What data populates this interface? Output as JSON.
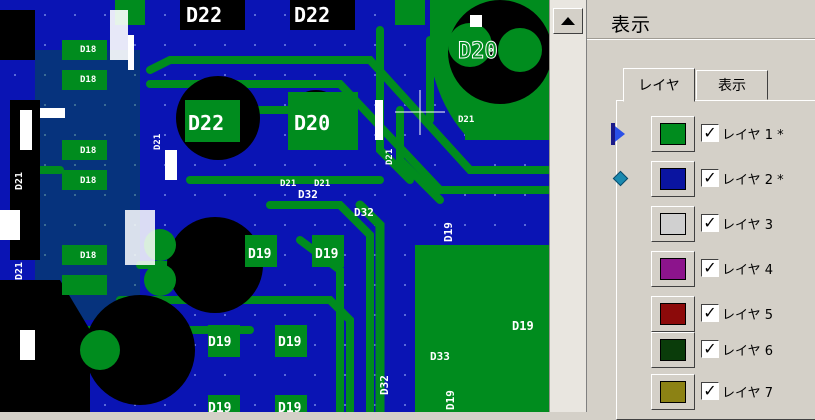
{
  "board": {
    "colors": {
      "background": "#0a14b4",
      "copper": "#008c1e",
      "copper_dark": "#006e18",
      "drill": "#000000",
      "silk": "#ffffff",
      "dot": "#5a6ad8"
    },
    "labels": {
      "d22": "D22",
      "d20": "D20",
      "d21": "D21",
      "d19": "D19",
      "d18": "D18",
      "d32": "D32",
      "d33": "D33"
    }
  },
  "scrollbar": {
    "up_icon": "scroll-up-arrow"
  },
  "panel": {
    "title": "表示",
    "tabs": [
      {
        "label": "レイヤ",
        "active": true
      },
      {
        "label": "表示",
        "active": false
      }
    ],
    "layers": [
      {
        "label": "レイヤ 1 *",
        "color": "#008c1e",
        "checked": true,
        "indicator": "active-layer"
      },
      {
        "label": "レイヤ 2 *",
        "color": "#0a14a0",
        "checked": true,
        "indicator": "secondary-layer"
      },
      {
        "label": "レイヤ 3",
        "color": "#d0d0d0",
        "checked": true,
        "indicator": ""
      },
      {
        "label": "レイヤ 4",
        "color": "#8c148c",
        "checked": true,
        "indicator": ""
      },
      {
        "label": "レイヤ 5",
        "color": "#8c0a0a",
        "checked": true,
        "indicator": ""
      },
      {
        "label": "レイヤ 6",
        "color": "#0a3c0a",
        "checked": true,
        "indicator": ""
      },
      {
        "label": "レイヤ 7",
        "color": "#8c8214",
        "checked": true,
        "indicator": ""
      }
    ]
  }
}
